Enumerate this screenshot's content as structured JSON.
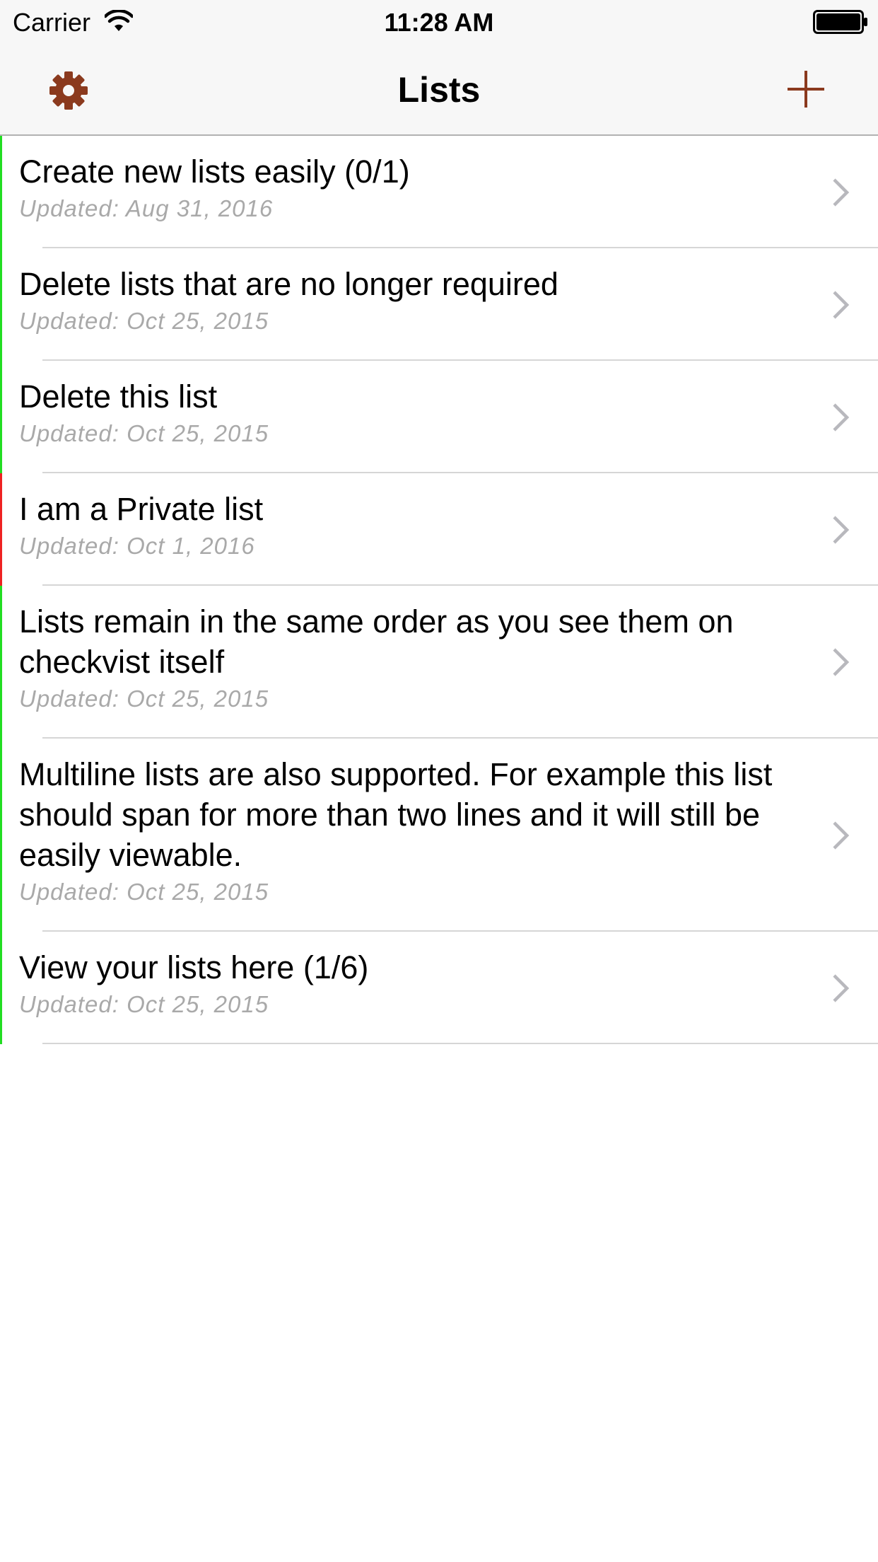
{
  "status_bar": {
    "carrier": "Carrier",
    "time": "11:28 AM",
    "wifi_icon": "wifi-icon",
    "battery_icon": "battery-icon"
  },
  "nav": {
    "title": "Lists",
    "left_icon": "gear-icon",
    "right_icon": "plus-icon"
  },
  "colors": {
    "accent": "#8b3a1e",
    "public_list": "#22dd22",
    "private_list": "#ee2222",
    "secondary_text": "#a9a9a9"
  },
  "lists": [
    {
      "title": "Create new lists easily (0/1)",
      "updated": "Updated: Aug 31, 2016",
      "indicator": "green"
    },
    {
      "title": "Delete lists that are no longer required",
      "updated": "Updated: Oct 25, 2015",
      "indicator": "green"
    },
    {
      "title": "Delete this list",
      "updated": "Updated: Oct 25, 2015",
      "indicator": "green"
    },
    {
      "title": "I am a Private list",
      "updated": "Updated: Oct 1, 2016",
      "indicator": "red"
    },
    {
      "title": "Lists remain in the same order as you see them on checkvist itself",
      "updated": "Updated: Oct 25, 2015",
      "indicator": "green"
    },
    {
      "title": "Multiline lists are also supported. For example this list should span for more than two lines and it will still be easily viewable.",
      "updated": "Updated: Oct 25, 2015",
      "indicator": "green"
    },
    {
      "title": "View your lists here (1/6)",
      "updated": "Updated: Oct 25, 2015",
      "indicator": "green"
    }
  ]
}
